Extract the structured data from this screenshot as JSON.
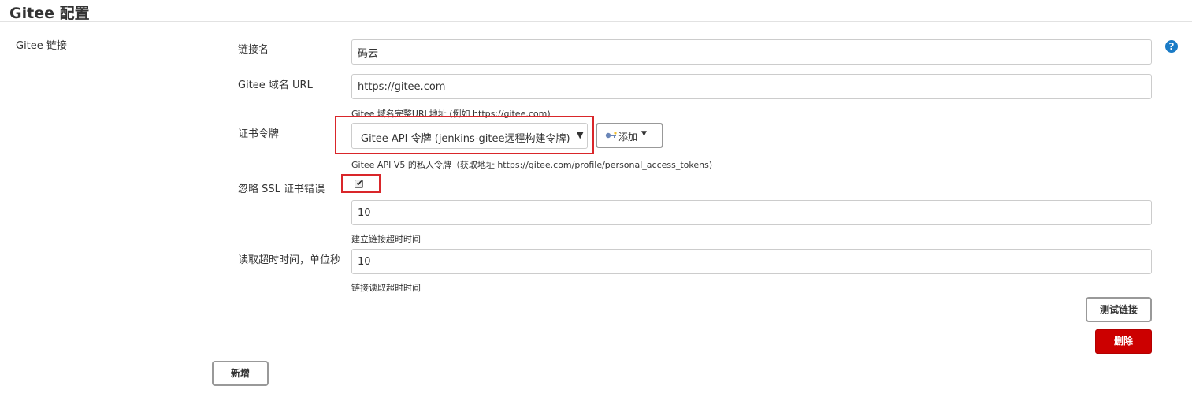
{
  "section": {
    "title": "Gitee 配置"
  },
  "connection": {
    "group_label": "Gitee 链接",
    "help_icon": "?",
    "name": {
      "label": "链接名",
      "value": "码云"
    },
    "host_url": {
      "label": "Gitee 域名 URL",
      "value": "https://gitee.com",
      "help": "Gitee 域名完整URL地址 (例如 https://gitee.com)"
    },
    "credentials": {
      "label": "证书令牌",
      "selected": "Gitee API 令牌 (jenkins-gitee远程构建令牌)",
      "add_label": "添加",
      "help": "Gitee API V5 的私人令牌（获取地址 https://gitee.com/profile/personal_access_tokens)"
    },
    "ignore_ssl": {
      "label": "忽略 SSL 证书错误",
      "checked": true
    },
    "connect_timeout": {
      "value": "10",
      "help": "建立链接超时时间"
    },
    "read_timeout": {
      "label": "读取超时时间，单位秒",
      "value": "10",
      "help": "链接读取超时时间"
    },
    "test_button": "测试链接",
    "delete_button": "删除"
  },
  "add_new_button": "新增",
  "colors": {
    "delete_bg": "#cc0000",
    "help_icon": "#1a7bc6",
    "highlight": "#d9262a"
  },
  "icons": {
    "help": "help-circle-icon",
    "key": "key-icon",
    "dropdown": "chevron-down-icon",
    "check": "checkmark-icon"
  }
}
